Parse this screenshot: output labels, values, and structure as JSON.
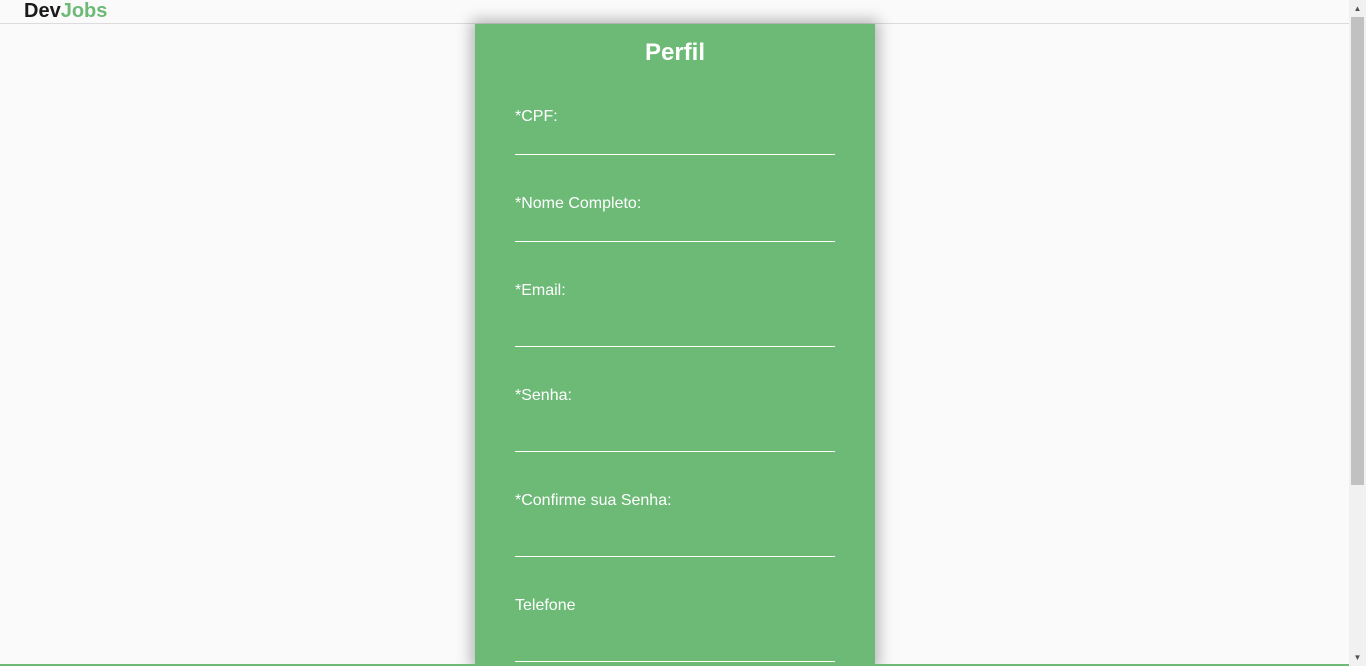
{
  "header": {
    "logo_part1": "Dev",
    "logo_part2": "Jobs"
  },
  "form": {
    "title": "Perfil",
    "fields": [
      {
        "label": "*CPF:",
        "value": ""
      },
      {
        "label": "*Nome Completo:",
        "value": ""
      },
      {
        "label": "*Email:",
        "value": ""
      },
      {
        "label": "*Senha:",
        "value": ""
      },
      {
        "label": "*Confirme sua Senha:",
        "value": ""
      },
      {
        "label": "Telefone",
        "value": ""
      }
    ]
  },
  "scrollbar": {
    "up_icon": "triangle-up",
    "down_icon": "triangle-down"
  },
  "colors": {
    "accent": "#6dba77",
    "background": "#fafafa",
    "text_dark": "#1a1a1a"
  }
}
